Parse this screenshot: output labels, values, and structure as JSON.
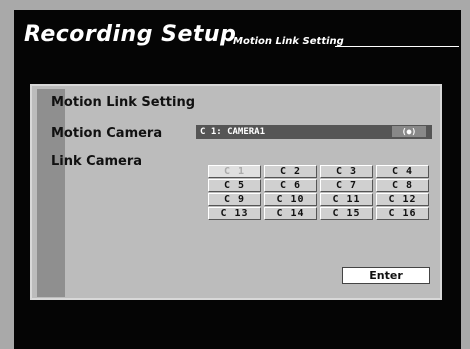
{
  "header": {
    "title": "Recording Setup",
    "subtitle": "Motion Link Setting"
  },
  "panel": {
    "heading": "Motion Link Setting",
    "motion_camera_label": "Motion Camera",
    "motion_camera_value": "C 1: CAMERA1",
    "motion_camera_button": "(●)",
    "link_camera_label": "Link Camera"
  },
  "link_cameras": [
    {
      "label": "C  1",
      "enabled": false
    },
    {
      "label": "C  2",
      "enabled": true
    },
    {
      "label": "C  3",
      "enabled": true
    },
    {
      "label": "C  4",
      "enabled": true
    },
    {
      "label": "C  5",
      "enabled": true
    },
    {
      "label": "C  6",
      "enabled": true
    },
    {
      "label": "C  7",
      "enabled": true
    },
    {
      "label": "C  8",
      "enabled": true
    },
    {
      "label": "C  9",
      "enabled": true
    },
    {
      "label": "C 10",
      "enabled": true
    },
    {
      "label": "C 11",
      "enabled": true
    },
    {
      "label": "C 12",
      "enabled": true
    },
    {
      "label": "C 13",
      "enabled": true
    },
    {
      "label": "C 14",
      "enabled": true
    },
    {
      "label": "C 15",
      "enabled": true
    },
    {
      "label": "C 16",
      "enabled": true
    }
  ],
  "enter_label": "Enter",
  "colors": {
    "screen_border": "#a9a9a9",
    "background": "#050505",
    "panel": "#bcbcbc",
    "field": "#555555"
  }
}
